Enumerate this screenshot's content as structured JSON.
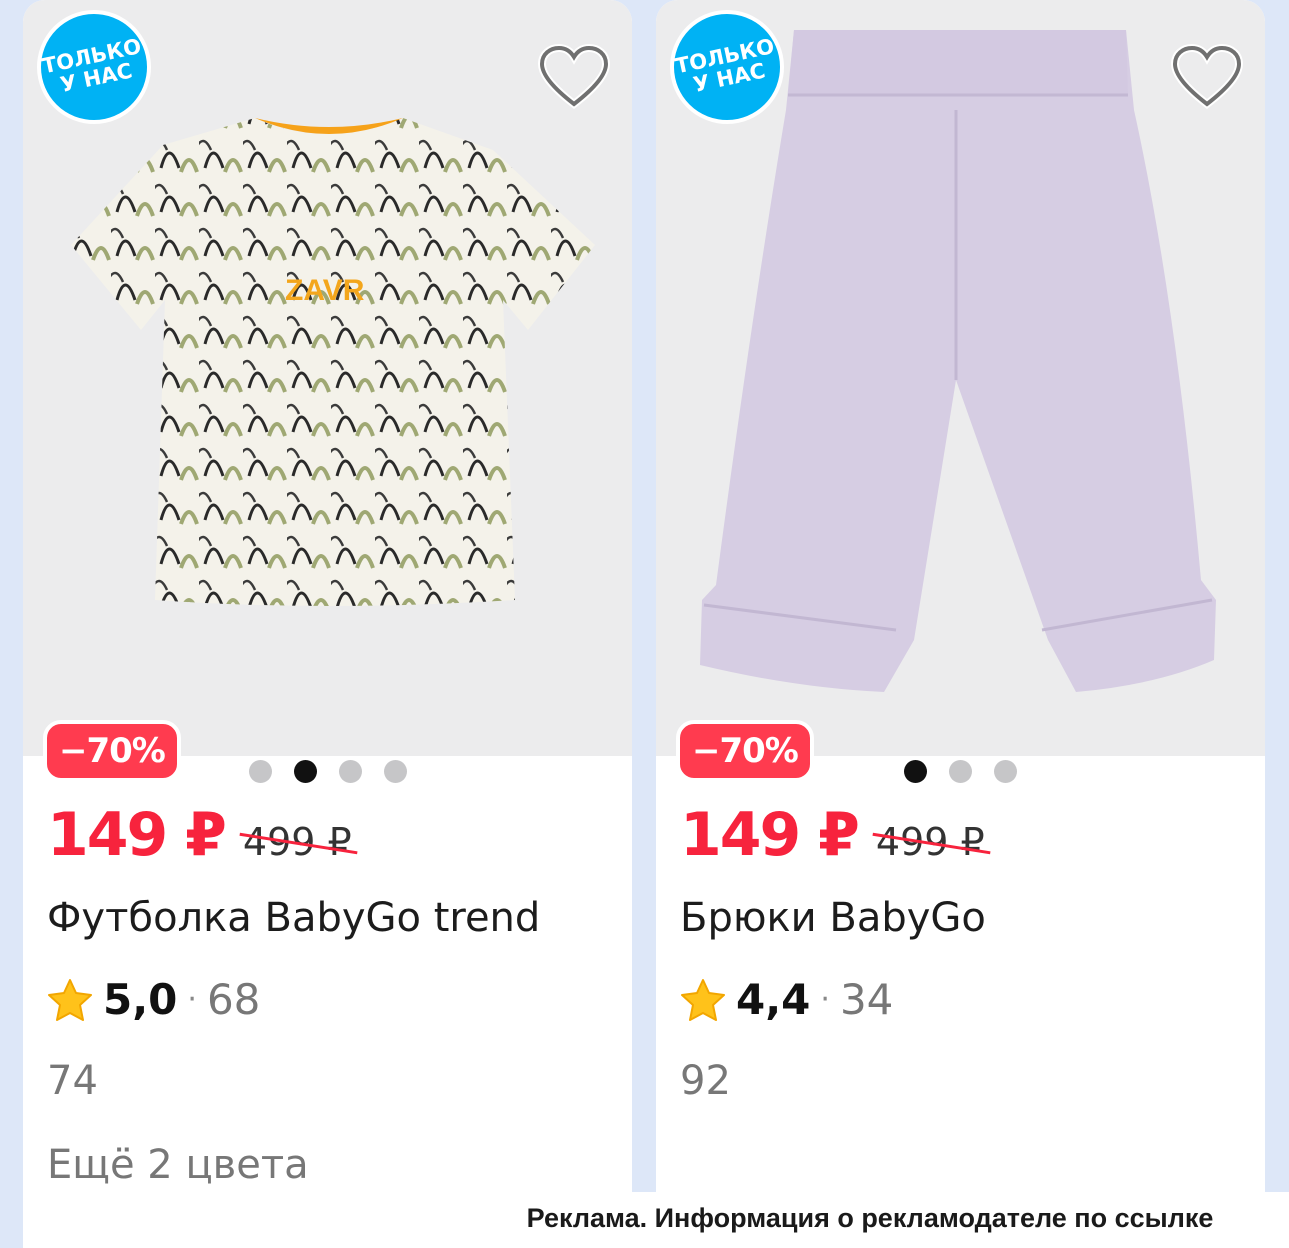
{
  "products": [
    {
      "badge": "ТОЛЬКО\nУ НАС",
      "discount": "−70%",
      "price": "149 ₽",
      "old_price": "499 ₽",
      "title": "Футболка BabyGo trend",
      "rating": "5,0",
      "separator": "·",
      "reviews": "68",
      "size": "74",
      "more_colors": "Ещё 2 цвета",
      "gallery_dots": 4,
      "gallery_active": 2,
      "print_text": "ZAVR"
    },
    {
      "badge": "ТОЛЬКО\nУ НАС",
      "discount": "−70%",
      "price": "149 ₽",
      "old_price": "499 ₽",
      "title": "Брюки BabyGo",
      "rating": "4,4",
      "separator": "·",
      "reviews": "34",
      "size": "92",
      "gallery_dots": 3,
      "gallery_active": 1
    }
  ],
  "ad_notice": "Реклама. Информация о рекламодателе по ссылке",
  "icons": {
    "favorite": "heart-outline-icon",
    "rating": "star-icon"
  },
  "colors": {
    "price": "#f7233d",
    "badge": "#00b2f4",
    "star": "#ffc21a"
  }
}
